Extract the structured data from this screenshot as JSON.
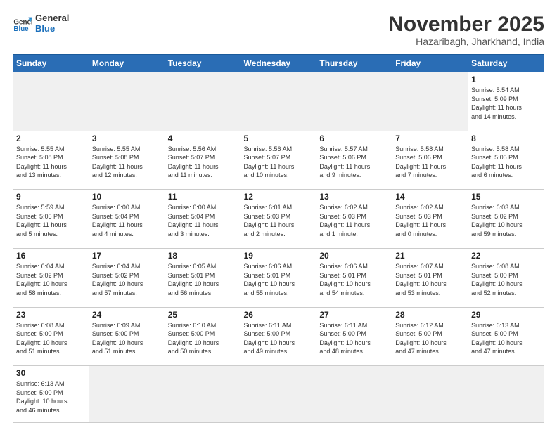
{
  "header": {
    "logo_general": "General",
    "logo_blue": "Blue",
    "month_year": "November 2025",
    "location": "Hazaribagh, Jharkhand, India"
  },
  "days_of_week": [
    "Sunday",
    "Monday",
    "Tuesday",
    "Wednesday",
    "Thursday",
    "Friday",
    "Saturday"
  ],
  "weeks": [
    [
      {
        "day": "",
        "info": "",
        "empty": true
      },
      {
        "day": "",
        "info": "",
        "empty": true
      },
      {
        "day": "",
        "info": "",
        "empty": true
      },
      {
        "day": "",
        "info": "",
        "empty": true
      },
      {
        "day": "",
        "info": "",
        "empty": true
      },
      {
        "day": "",
        "info": "",
        "empty": true
      },
      {
        "day": "1",
        "info": "Sunrise: 5:54 AM\nSunset: 5:09 PM\nDaylight: 11 hours\nand 14 minutes."
      }
    ],
    [
      {
        "day": "2",
        "info": "Sunrise: 5:55 AM\nSunset: 5:08 PM\nDaylight: 11 hours\nand 13 minutes."
      },
      {
        "day": "3",
        "info": "Sunrise: 5:55 AM\nSunset: 5:08 PM\nDaylight: 11 hours\nand 12 minutes."
      },
      {
        "day": "4",
        "info": "Sunrise: 5:56 AM\nSunset: 5:07 PM\nDaylight: 11 hours\nand 11 minutes."
      },
      {
        "day": "5",
        "info": "Sunrise: 5:56 AM\nSunset: 5:07 PM\nDaylight: 11 hours\nand 10 minutes."
      },
      {
        "day": "6",
        "info": "Sunrise: 5:57 AM\nSunset: 5:06 PM\nDaylight: 11 hours\nand 9 minutes."
      },
      {
        "day": "7",
        "info": "Sunrise: 5:58 AM\nSunset: 5:06 PM\nDaylight: 11 hours\nand 7 minutes."
      },
      {
        "day": "8",
        "info": "Sunrise: 5:58 AM\nSunset: 5:05 PM\nDaylight: 11 hours\nand 6 minutes."
      }
    ],
    [
      {
        "day": "9",
        "info": "Sunrise: 5:59 AM\nSunset: 5:05 PM\nDaylight: 11 hours\nand 5 minutes."
      },
      {
        "day": "10",
        "info": "Sunrise: 6:00 AM\nSunset: 5:04 PM\nDaylight: 11 hours\nand 4 minutes."
      },
      {
        "day": "11",
        "info": "Sunrise: 6:00 AM\nSunset: 5:04 PM\nDaylight: 11 hours\nand 3 minutes."
      },
      {
        "day": "12",
        "info": "Sunrise: 6:01 AM\nSunset: 5:03 PM\nDaylight: 11 hours\nand 2 minutes."
      },
      {
        "day": "13",
        "info": "Sunrise: 6:02 AM\nSunset: 5:03 PM\nDaylight: 11 hours\nand 1 minute."
      },
      {
        "day": "14",
        "info": "Sunrise: 6:02 AM\nSunset: 5:03 PM\nDaylight: 11 hours\nand 0 minutes."
      },
      {
        "day": "15",
        "info": "Sunrise: 6:03 AM\nSunset: 5:02 PM\nDaylight: 10 hours\nand 59 minutes."
      }
    ],
    [
      {
        "day": "16",
        "info": "Sunrise: 6:04 AM\nSunset: 5:02 PM\nDaylight: 10 hours\nand 58 minutes."
      },
      {
        "day": "17",
        "info": "Sunrise: 6:04 AM\nSunset: 5:02 PM\nDaylight: 10 hours\nand 57 minutes."
      },
      {
        "day": "18",
        "info": "Sunrise: 6:05 AM\nSunset: 5:01 PM\nDaylight: 10 hours\nand 56 minutes."
      },
      {
        "day": "19",
        "info": "Sunrise: 6:06 AM\nSunset: 5:01 PM\nDaylight: 10 hours\nand 55 minutes."
      },
      {
        "day": "20",
        "info": "Sunrise: 6:06 AM\nSunset: 5:01 PM\nDaylight: 10 hours\nand 54 minutes."
      },
      {
        "day": "21",
        "info": "Sunrise: 6:07 AM\nSunset: 5:01 PM\nDaylight: 10 hours\nand 53 minutes."
      },
      {
        "day": "22",
        "info": "Sunrise: 6:08 AM\nSunset: 5:00 PM\nDaylight: 10 hours\nand 52 minutes."
      }
    ],
    [
      {
        "day": "23",
        "info": "Sunrise: 6:08 AM\nSunset: 5:00 PM\nDaylight: 10 hours\nand 51 minutes."
      },
      {
        "day": "24",
        "info": "Sunrise: 6:09 AM\nSunset: 5:00 PM\nDaylight: 10 hours\nand 51 minutes."
      },
      {
        "day": "25",
        "info": "Sunrise: 6:10 AM\nSunset: 5:00 PM\nDaylight: 10 hours\nand 50 minutes."
      },
      {
        "day": "26",
        "info": "Sunrise: 6:11 AM\nSunset: 5:00 PM\nDaylight: 10 hours\nand 49 minutes."
      },
      {
        "day": "27",
        "info": "Sunrise: 6:11 AM\nSunset: 5:00 PM\nDaylight: 10 hours\nand 48 minutes."
      },
      {
        "day": "28",
        "info": "Sunrise: 6:12 AM\nSunset: 5:00 PM\nDaylight: 10 hours\nand 47 minutes."
      },
      {
        "day": "29",
        "info": "Sunrise: 6:13 AM\nSunset: 5:00 PM\nDaylight: 10 hours\nand 47 minutes."
      }
    ],
    [
      {
        "day": "30",
        "info": "Sunrise: 6:13 AM\nSunset: 5:00 PM\nDaylight: 10 hours\nand 46 minutes."
      },
      {
        "day": "",
        "info": "",
        "empty": true
      },
      {
        "day": "",
        "info": "",
        "empty": true
      },
      {
        "day": "",
        "info": "",
        "empty": true
      },
      {
        "day": "",
        "info": "",
        "empty": true
      },
      {
        "day": "",
        "info": "",
        "empty": true
      },
      {
        "day": "",
        "info": "",
        "empty": true
      }
    ]
  ]
}
